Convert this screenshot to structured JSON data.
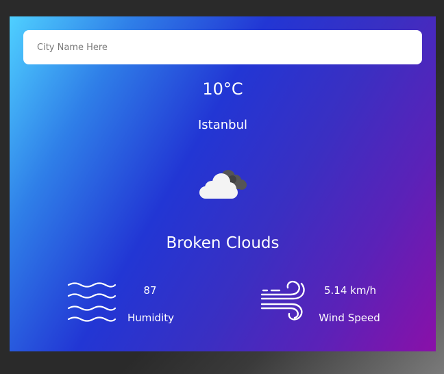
{
  "search": {
    "placeholder": "City Name Here",
    "value": ""
  },
  "weather": {
    "temperature": "10°C",
    "city": "Istanbul",
    "description": "Broken Clouds",
    "icon": "broken-clouds-icon"
  },
  "stats": {
    "humidity": {
      "value": "87",
      "label": "Humidity",
      "icon": "humidity-waves-icon"
    },
    "wind": {
      "value": "5.14 km/h",
      "label": "Wind Speed",
      "icon": "wind-icon"
    }
  },
  "colors": {
    "gradient_start": "#4fd0ff",
    "gradient_mid": "#2236d4",
    "gradient_end": "#8a10a8",
    "text": "#ffffff"
  }
}
